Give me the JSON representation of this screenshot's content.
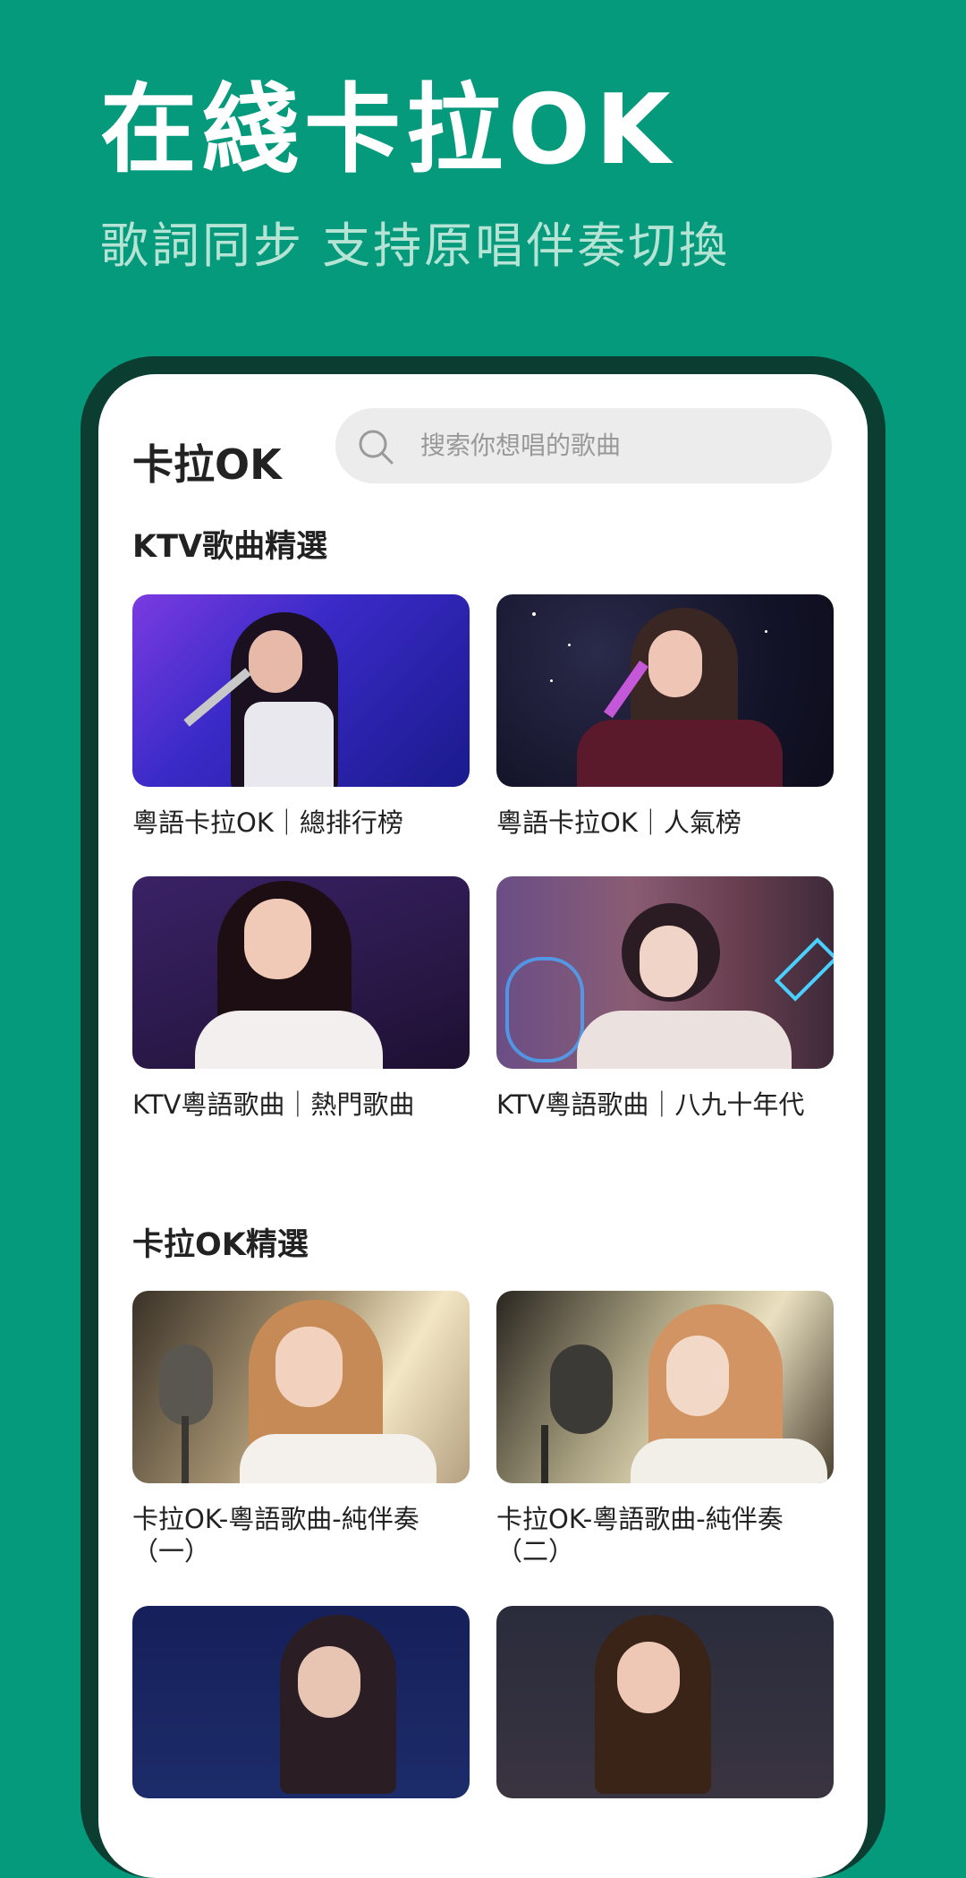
{
  "promo": {
    "title": "在綫卡拉OK",
    "subtitle": "歌詞同步  支持原唱伴奏切換"
  },
  "app": {
    "title": "卡拉OK",
    "search_placeholder": "搜索你想唱的歌曲"
  },
  "sections": [
    {
      "title": "KTV歌曲精選",
      "cards": [
        {
          "caption": "粵語卡拉OK｜總排行榜",
          "image": "singer-microphone-blue-stage"
        },
        {
          "caption": "粵語卡拉OK｜人氣榜",
          "image": "singer-microphone-night-stage"
        },
        {
          "caption": "KTV粵語歌曲｜熱門歌曲",
          "image": "singer-purple-stage"
        },
        {
          "caption": "KTV粵語歌曲｜八九十年代",
          "image": "singer-retro-stage"
        }
      ]
    },
    {
      "title": "卡拉OK精選",
      "cards": [
        {
          "caption_line1": "卡拉OK-粵語歌曲-純伴奏",
          "caption_line2": "（一）",
          "image": "singer-studio-mic"
        },
        {
          "caption_line1": "卡拉OK-粵語歌曲-純伴奏",
          "caption_line2": "（二）",
          "image": "singer-studio-mic-2"
        },
        {
          "image": "singer-blue-stage-partial"
        },
        {
          "image": "singer-dark-partial"
        }
      ]
    }
  ],
  "colors": {
    "background": "#069a7d",
    "phone_frame": "#0b3d31",
    "subtitle": "#b6e4d4"
  }
}
